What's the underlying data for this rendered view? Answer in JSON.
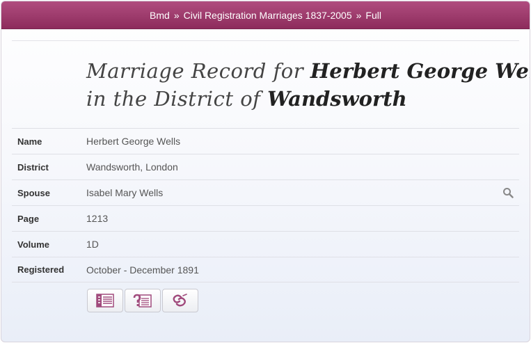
{
  "breadcrumb": {
    "items": [
      "Bmd",
      "Civil Registration Marriages 1837-2005",
      "Full"
    ],
    "separator": "»"
  },
  "title": {
    "prefix": "Marriage Record for",
    "person": "Herbert George Wells",
    "district_prefix": "in the District of",
    "district": "Wandsworth"
  },
  "details": {
    "rows": [
      {
        "label": "Name",
        "value": "Herbert George Wells"
      },
      {
        "label": "District",
        "value": "Wandsworth, London"
      },
      {
        "label": "Spouse",
        "value": "Isabel Mary Wells"
      },
      {
        "label": "Page",
        "value": "1213"
      },
      {
        "label": "Volume",
        "value": "1D"
      },
      {
        "label": "Registered",
        "value": "October - December 1891"
      }
    ]
  },
  "icons": {
    "spouse_search": "search-icon",
    "actions": [
      "document-list-icon",
      "document-question-icon",
      "link-icon"
    ]
  },
  "colors": {
    "header_top": "#b04d7f",
    "header_bottom": "#8d2c5c",
    "icon_accent": "#a04a7c"
  }
}
